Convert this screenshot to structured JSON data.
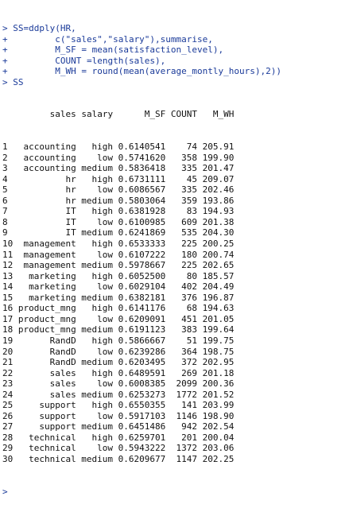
{
  "console": {
    "input_lines": [
      "> SS=ddply(HR,",
      "+         c(\"sales\",\"salary\"),summarise,",
      "+         M_SF = mean(satisfaction_level),",
      "+         COUNT =length(sales),",
      "+         M_WH = round(mean(average_montly_hours),2))",
      "> SS"
    ],
    "table": {
      "columns": [
        "sales",
        "salary",
        "M_SF",
        "COUNT",
        "M_WH"
      ],
      "header_line": "         sales salary      M_SF COUNT   M_WH",
      "rows": [
        {
          "idx": "1",
          "sales": "accounting",
          "salary": "high",
          "M_SF": "0.6140541",
          "COUNT": "74",
          "M_WH": "205.91"
        },
        {
          "idx": "2",
          "sales": "accounting",
          "salary": "low",
          "M_SF": "0.5741620",
          "COUNT": "358",
          "M_WH": "199.90"
        },
        {
          "idx": "3",
          "sales": "accounting",
          "salary": "medium",
          "M_SF": "0.5836418",
          "COUNT": "335",
          "M_WH": "201.47"
        },
        {
          "idx": "4",
          "sales": "hr",
          "salary": "high",
          "M_SF": "0.6731111",
          "COUNT": "45",
          "M_WH": "209.07"
        },
        {
          "idx": "5",
          "sales": "hr",
          "salary": "low",
          "M_SF": "0.6086567",
          "COUNT": "335",
          "M_WH": "202.46"
        },
        {
          "idx": "6",
          "sales": "hr",
          "salary": "medium",
          "M_SF": "0.5803064",
          "COUNT": "359",
          "M_WH": "193.86"
        },
        {
          "idx": "7",
          "sales": "IT",
          "salary": "high",
          "M_SF": "0.6381928",
          "COUNT": "83",
          "M_WH": "194.93"
        },
        {
          "idx": "8",
          "sales": "IT",
          "salary": "low",
          "M_SF": "0.6100985",
          "COUNT": "609",
          "M_WH": "201.38"
        },
        {
          "idx": "9",
          "sales": "IT",
          "salary": "medium",
          "M_SF": "0.6241869",
          "COUNT": "535",
          "M_WH": "204.30"
        },
        {
          "idx": "10",
          "sales": "management",
          "salary": "high",
          "M_SF": "0.6533333",
          "COUNT": "225",
          "M_WH": "200.25"
        },
        {
          "idx": "11",
          "sales": "management",
          "salary": "low",
          "M_SF": "0.6107222",
          "COUNT": "180",
          "M_WH": "200.74"
        },
        {
          "idx": "12",
          "sales": "management",
          "salary": "medium",
          "M_SF": "0.5978667",
          "COUNT": "225",
          "M_WH": "202.65"
        },
        {
          "idx": "13",
          "sales": "marketing",
          "salary": "high",
          "M_SF": "0.6052500",
          "COUNT": "80",
          "M_WH": "185.57"
        },
        {
          "idx": "14",
          "sales": "marketing",
          "salary": "low",
          "M_SF": "0.6029104",
          "COUNT": "402",
          "M_WH": "204.49"
        },
        {
          "idx": "15",
          "sales": "marketing",
          "salary": "medium",
          "M_SF": "0.6382181",
          "COUNT": "376",
          "M_WH": "196.87"
        },
        {
          "idx": "16",
          "sales": "product_mng",
          "salary": "high",
          "M_SF": "0.6141176",
          "COUNT": "68",
          "M_WH": "194.63"
        },
        {
          "idx": "17",
          "sales": "product_mng",
          "salary": "low",
          "M_SF": "0.6209091",
          "COUNT": "451",
          "M_WH": "201.05"
        },
        {
          "idx": "18",
          "sales": "product_mng",
          "salary": "medium",
          "M_SF": "0.6191123",
          "COUNT": "383",
          "M_WH": "199.64"
        },
        {
          "idx": "19",
          "sales": "RandD",
          "salary": "high",
          "M_SF": "0.5866667",
          "COUNT": "51",
          "M_WH": "199.75"
        },
        {
          "idx": "20",
          "sales": "RandD",
          "salary": "low",
          "M_SF": "0.6239286",
          "COUNT": "364",
          "M_WH": "198.75"
        },
        {
          "idx": "21",
          "sales": "RandD",
          "salary": "medium",
          "M_SF": "0.6203495",
          "COUNT": "372",
          "M_WH": "202.95"
        },
        {
          "idx": "22",
          "sales": "sales",
          "salary": "high",
          "M_SF": "0.6489591",
          "COUNT": "269",
          "M_WH": "201.18"
        },
        {
          "idx": "23",
          "sales": "sales",
          "salary": "low",
          "M_SF": "0.6008385",
          "COUNT": "2099",
          "M_WH": "200.36"
        },
        {
          "idx": "24",
          "sales": "sales",
          "salary": "medium",
          "M_SF": "0.6253273",
          "COUNT": "1772",
          "M_WH": "201.52"
        },
        {
          "idx": "25",
          "sales": "support",
          "salary": "high",
          "M_SF": "0.6550355",
          "COUNT": "141",
          "M_WH": "203.99"
        },
        {
          "idx": "26",
          "sales": "support",
          "salary": "low",
          "M_SF": "0.5917103",
          "COUNT": "1146",
          "M_WH": "198.90"
        },
        {
          "idx": "27",
          "sales": "support",
          "salary": "medium",
          "M_SF": "0.6451486",
          "COUNT": "942",
          "M_WH": "202.54"
        },
        {
          "idx": "28",
          "sales": "technical",
          "salary": "high",
          "M_SF": "0.6259701",
          "COUNT": "201",
          "M_WH": "200.04"
        },
        {
          "idx": "29",
          "sales": "technical",
          "salary": "low",
          "M_SF": "0.5943222",
          "COUNT": "1372",
          "M_WH": "203.06"
        },
        {
          "idx": "30",
          "sales": "technical",
          "salary": "medium",
          "M_SF": "0.6209677",
          "COUNT": "1147",
          "M_WH": "202.25"
        }
      ]
    },
    "final_prompt": ">",
    "colors": {
      "input_text": "#1a3a99",
      "output_text": "#111111",
      "background": "#ffffff"
    }
  }
}
